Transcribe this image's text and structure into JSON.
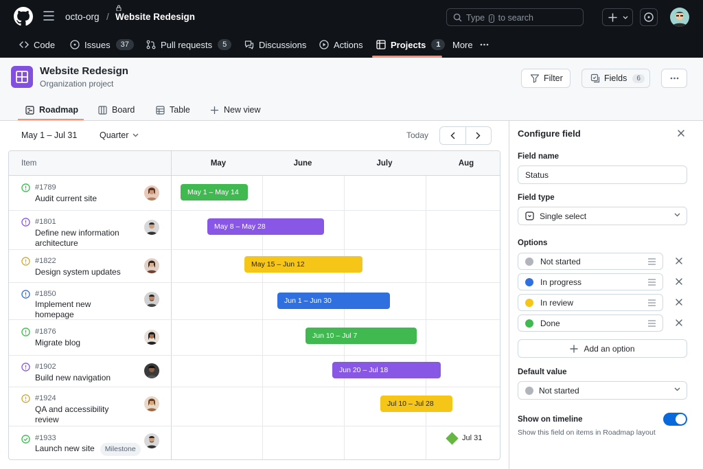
{
  "header": {
    "org": "octo-org",
    "separator": "/",
    "repo": "Website Redesign",
    "search_prefix": "Type",
    "search_key": "/",
    "search_suffix": "to search"
  },
  "repo_tabs": [
    {
      "label": "Code",
      "icon": "code-icon"
    },
    {
      "label": "Issues",
      "count": "37",
      "icon": "issue-icon"
    },
    {
      "label": "Pull requests",
      "count": "5",
      "icon": "pull-request-icon"
    },
    {
      "label": "Discussions",
      "icon": "discussion-icon"
    },
    {
      "label": "Actions",
      "icon": "actions-icon"
    },
    {
      "label": "Projects",
      "count": "1",
      "icon": "project-icon",
      "active": true
    },
    {
      "label": "More",
      "icon": "more-icon"
    }
  ],
  "project": {
    "title": "Website Redesign",
    "subtitle": "Organization project",
    "filter_label": "Filter",
    "fields_label": "Fields",
    "fields_count": "6"
  },
  "views": [
    {
      "label": "Roadmap",
      "active": true
    },
    {
      "label": "Board"
    },
    {
      "label": "Table"
    },
    {
      "label": "New view"
    }
  ],
  "roadmap": {
    "range": "May 1 – Jul 31",
    "zoom": "Quarter",
    "today": "Today",
    "item_header": "Item",
    "months": [
      "May",
      "June",
      "July",
      "Aug"
    ],
    "items": [
      {
        "num": "#1789",
        "title": "Audit current site",
        "bar": "May 1 – May 14",
        "color": "#3fb950",
        "status": "Done"
      },
      {
        "num": "#1801",
        "title": "Define new information architecture",
        "bar": "May 8 – May 28",
        "color": "#8957e5",
        "status": "In review"
      },
      {
        "num": "#1822",
        "title": "Design system updates",
        "bar": "May 15 – Jun 12",
        "color": "#f5c518",
        "status": "In review"
      },
      {
        "num": "#1850",
        "title": "Implement new homepage",
        "bar": "Jun 1 – Jun 30",
        "color": "#2f6fe0",
        "status": "In progress"
      },
      {
        "num": "#1876",
        "title": "Migrate blog",
        "bar": "Jun 10 – Jul 7",
        "color": "#3fb950",
        "status": "Done"
      },
      {
        "num": "#1902",
        "title": "Build new navigation",
        "bar": "Jun 20 – Jul 18",
        "color": "#8957e5",
        "status": "In review"
      },
      {
        "num": "#1924",
        "title": "QA and accessibility review",
        "bar": "Jul 10 – Jul 28",
        "color": "#f5c518",
        "status": "In review"
      },
      {
        "num": "#1933",
        "title": "Launch new site",
        "badge": "Milestone",
        "milestone": "Jul 31",
        "color": "#65b741",
        "status": "Done"
      }
    ]
  },
  "panel": {
    "title": "Configure field",
    "field_name_label": "Field name",
    "field_name_value": "Status",
    "field_type_label": "Field type",
    "field_type_value": "Single select",
    "options_label": "Options",
    "options": [
      {
        "label": "Not started",
        "color": "#b1b5bb"
      },
      {
        "label": "In progress",
        "color": "#2f6fe0"
      },
      {
        "label": "In review",
        "color": "#f5c518"
      },
      {
        "label": "Done",
        "color": "#3fb950"
      }
    ],
    "add_option": "Add an option",
    "default_label": "Default value",
    "default_value": "Not started",
    "timeline_label": "Show on timeline",
    "timeline_enabled": true,
    "timeline_help": "Show this field on items in Roadmap layout"
  }
}
